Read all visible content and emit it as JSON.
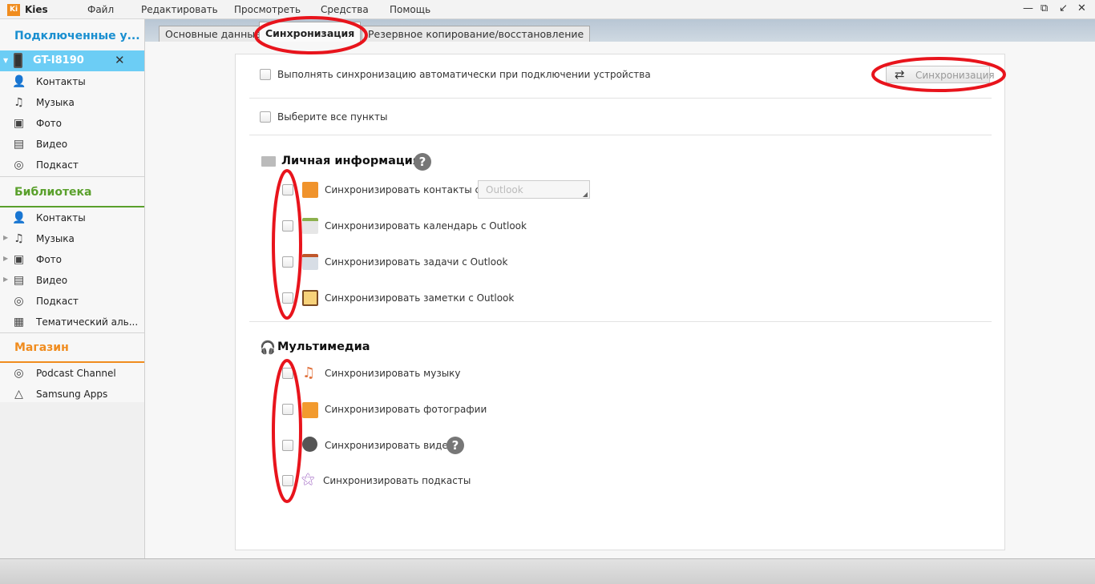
{
  "app": {
    "logo": "Ki",
    "name": "Kies"
  },
  "menu": [
    "Файл",
    "Редактировать",
    "Просмотреть",
    "Средства",
    "Помощь"
  ],
  "window_controls": {
    "minimize": "—",
    "restore": "⧉",
    "compact": "↙",
    "close": "✕"
  },
  "sidebar": {
    "connected_title": "Подключенные у...",
    "device": {
      "name": "GT-I8190",
      "close": "✕"
    },
    "device_items": [
      "Контакты",
      "Музыка",
      "Фото",
      "Видео",
      "Подкаст"
    ],
    "library_title": "Библиотека",
    "library_items": [
      "Контакты",
      "Музыка",
      "Фото",
      "Видео",
      "Подкаст",
      "Тематический аль..."
    ],
    "store_title": "Магазин",
    "store_items": [
      "Podcast Channel",
      "Samsung Apps"
    ]
  },
  "tabs": [
    "Основные данные",
    "Синхронизация",
    "Резервное копирование/восстановление"
  ],
  "sync": {
    "auto_label": "Выполнять синхронизацию автоматически при подключении устройства",
    "sync_button": "Синхронизация",
    "select_all": "Выберите все пункты",
    "personal_title": "Личная информация",
    "help": "?",
    "personal_items": [
      "Синхронизировать контакты с",
      "Синхронизировать календарь с Outlook",
      "Синхронизировать задачи с Outlook",
      "Синхронизировать заметки с Outlook"
    ],
    "contacts_target": "Outlook",
    "multimedia_title": "Мультимедиа",
    "media_items": [
      "Синхронизировать музыку",
      "Синхронизировать фотографии",
      "Синхронизировать видео",
      "Синхронизировать подкасты"
    ]
  },
  "colors": {
    "connected": "#1a8fd0",
    "library": "#5aa02c",
    "store": "#f08c1e",
    "device_bg": "#6ccdf5",
    "annotation": "#e8141c"
  }
}
